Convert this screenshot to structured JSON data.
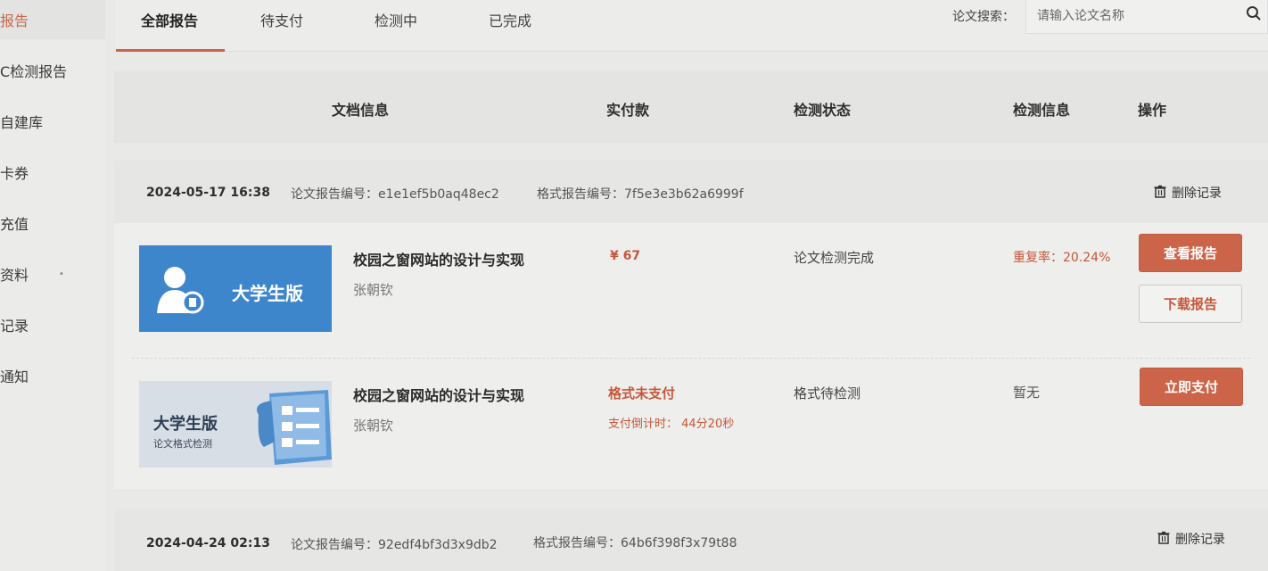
{
  "sidebar": {
    "items": [
      {
        "label": "报告",
        "active": true
      },
      {
        "label": "C检测报告"
      },
      {
        "label": "自建库"
      },
      {
        "label": "卡券"
      },
      {
        "label": "充值"
      },
      {
        "label": "资料"
      },
      {
        "label": "记录"
      },
      {
        "label": "通知"
      }
    ]
  },
  "tabs": [
    {
      "label": "全部报告",
      "active": true
    },
    {
      "label": "待支付"
    },
    {
      "label": "检测中"
    },
    {
      "label": "已完成"
    }
  ],
  "search": {
    "label": "论文搜索：",
    "placeholder": "请输入论文名称"
  },
  "table_header": {
    "doc_info": "文档信息",
    "paid": "实付款",
    "status": "检测状态",
    "check_info": "检测信息",
    "actions": "操作"
  },
  "records": [
    {
      "datetime": "2024-05-17 16:38",
      "report_no": "论文报告编号：e1e1ef5b0aq48ec2",
      "format_no": "格式报告编号：7f5e3e3b62a6999f",
      "delete_label": "删除记录",
      "rows": [
        {
          "thumb_label": "大学生版",
          "title": "校园之窗网站的设计与实现",
          "author": "张朝钦",
          "price": "¥ 67",
          "status": "论文检测完成",
          "info": "重复率：20.24%",
          "btn_view": "查看报告",
          "btn_download": "下载报告"
        },
        {
          "thumb_label": "大学生版",
          "thumb_sub": "论文格式检测",
          "title": "校园之窗网站的设计与实现",
          "author": "张朝钦",
          "pay_status": "格式未支付",
          "countdown": "支付倒计时：  44分20秒",
          "status": "格式待检测",
          "info": "暂无",
          "btn_pay": "立即支付"
        }
      ]
    },
    {
      "datetime": "2024-04-24 02:13",
      "report_no": "论文报告编号：92edf4bf3d3x9db2",
      "format_no": "格式报告编号：64b6f398f3x79t88",
      "delete_label": "删除记录"
    }
  ],
  "colors": {
    "accent": "#cb6448",
    "thumb_blue": "#3e86cc",
    "background": "#e9e9e7"
  }
}
